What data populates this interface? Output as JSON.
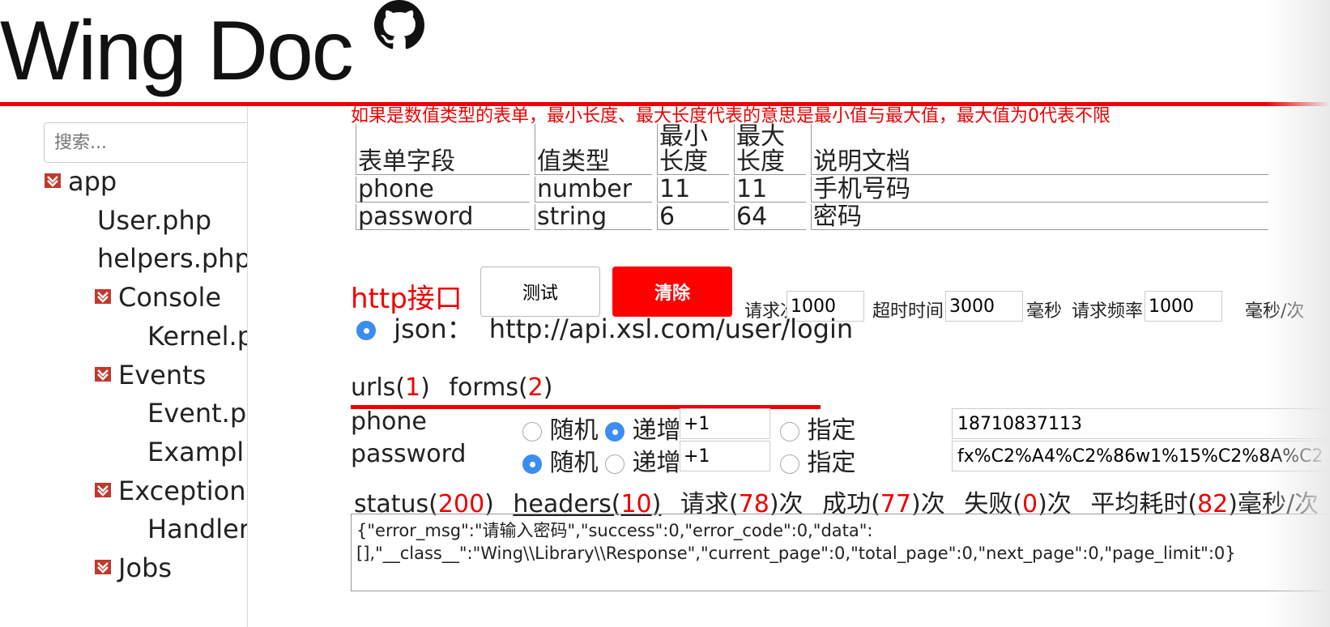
{
  "header": {
    "logo_text": "Wing Doc",
    "github_icon": "github-icon"
  },
  "sidebar": {
    "search_placeholder": "搜索...",
    "items": [
      {
        "label": "app",
        "folder": true
      },
      {
        "label": "User.php",
        "folder": false
      },
      {
        "label": "helpers.php",
        "folder": false
      },
      {
        "label": "Console",
        "folder": true
      },
      {
        "label": "Kernel.p",
        "folder": false
      },
      {
        "label": "Events",
        "folder": true
      },
      {
        "label": "Event.p",
        "folder": false
      },
      {
        "label": "Exampl",
        "folder": false
      },
      {
        "label": "Exceptions",
        "folder": true
      },
      {
        "label": "Handler",
        "folder": false
      },
      {
        "label": "Jobs",
        "folder": true
      }
    ]
  },
  "main": {
    "note": "如果是数值类型的表单，最小长度、最大长度代表的意思是最小值与最大值，最大值为0代表不限",
    "table": {
      "headers": [
        "表单字段",
        "值类型",
        "最小长度",
        "最大长度",
        "说明文档"
      ],
      "header_lines": [
        [
          "表单字段"
        ],
        [
          "值类型"
        ],
        [
          "最小",
          "长度"
        ],
        [
          "最大",
          "长度"
        ],
        [
          "说明文档"
        ]
      ],
      "rows": [
        [
          "phone",
          "number",
          "11",
          "11",
          "手机号码"
        ],
        [
          "password",
          "string",
          "6",
          "64",
          "密码"
        ]
      ]
    },
    "http": {
      "title": "http接口",
      "test_button": "测试",
      "clear_button": "清除",
      "request_count_label": "请求次数",
      "request_count": "1000",
      "timeout_label": "超时时间",
      "timeout": "3000",
      "ms_label": "毫秒",
      "rate_label": "请求频率",
      "rate": "1000",
      "rate_unit": "毫秒/次",
      "json_label": "json：",
      "url": "http://api.xsl.com/user/login"
    },
    "tabs": {
      "urls_label": "urls(",
      "urls_count": "1",
      "forms_label": "forms(",
      "forms_count": "2",
      "close": ")"
    },
    "forms": [
      {
        "name": "phone",
        "random": "随机",
        "increment": "递增",
        "step": "+1",
        "specify": "指定",
        "value": "18710837113",
        "selected": "increment"
      },
      {
        "name": "password",
        "random": "随机",
        "increment": "递增",
        "step": "+1",
        "specify": "指定",
        "value": "fx%C2%A4%C2%86w1%15%C2%8A%C2",
        "selected": "random"
      }
    ],
    "stats": {
      "status_label": "status(",
      "status": "200",
      "headers_label": "headers(",
      "headers": "10",
      "request_label": "请求(",
      "request": "78",
      "success_label": "成功(",
      "success": "77",
      "fail_label": "失败(",
      "fail": "0",
      "avg_label": "平均耗时(",
      "avg": "82",
      "times_suffix": ")次",
      "avg_suffix": ")毫秒/次"
    },
    "response": "{\"error_msg\":\"请输入密码\",\"success\":0,\"error_code\":0,\"data\":\n[],\"__class__\":\"Wing\\\\Library\\\\Response\",\"current_page\":0,\"total_page\":0,\"next_page\":0,\"page_limit\":0}"
  },
  "colors": {
    "accent": "#ee0000",
    "radio": "#3b8df0"
  }
}
